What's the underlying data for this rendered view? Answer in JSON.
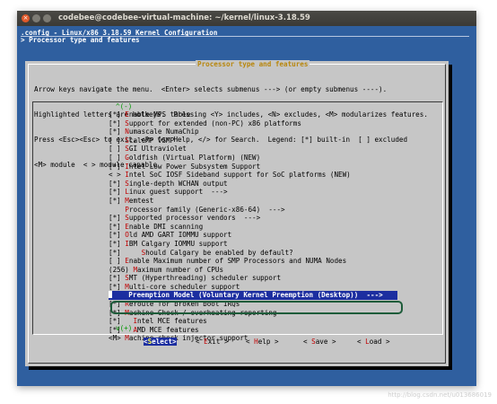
{
  "window": {
    "title": "codebee@codebee-virtual-machine: ~/kernel/linux-3.18.59",
    "close_glyph": "×"
  },
  "terminal": {
    "config_header": ".config - Linux/x86 3.18.59 Kernel Configuration",
    "breadcrumb": "> Processor type and features"
  },
  "dialog": {
    "title": "Processor type and features",
    "help_lines": [
      "Arrow keys navigate the menu.  <Enter> selects submenus ---> (or empty submenus ----).",
      "Highlighted letters are hotkeys.  Pressing <Y> includes, <N> excludes, <M> modularizes features.",
      "Press <Esc><Esc> to exit, <?> for Help, </> for Search.  Legend: [*] built-in  [ ] excluded",
      "<M> module  < > module capable"
    ],
    "scroll_up": "^(-)",
    "scroll_down": "v(+)",
    "items": [
      {
        "prefix": "[*] ",
        "hotkey": "E",
        "rest": "nable MPS table"
      },
      {
        "prefix": "[*] ",
        "hotkey": "S",
        "rest": "upport for extended (non-PC) x86 platforms"
      },
      {
        "prefix": "[*] ",
        "hotkey": "N",
        "rest": "umascale NumaChip"
      },
      {
        "prefix": "[ ] ",
        "hotkey": "S",
        "rest": "caleMP vSMP"
      },
      {
        "prefix": "[ ] ",
        "hotkey": "S",
        "rest": "GI Ultraviolet"
      },
      {
        "prefix": "[ ] ",
        "hotkey": "G",
        "rest": "oldfish (Virtual Platform) (NEW)"
      },
      {
        "prefix": "[*] ",
        "hotkey": "I",
        "rest": "ntel Low Power Subsystem Support"
      },
      {
        "prefix": "< > ",
        "hotkey": "I",
        "rest": "ntel SoC IOSF Sideband support for SoC platforms (NEW)"
      },
      {
        "prefix": "[*] ",
        "hotkey": "S",
        "rest": "ingle-depth WCHAN output"
      },
      {
        "prefix": "[*] ",
        "hotkey": "L",
        "rest": "inux guest support  --->"
      },
      {
        "prefix": "[*] ",
        "hotkey": "M",
        "rest": "emtest"
      },
      {
        "prefix": "    ",
        "hotkey": "P",
        "rest": "rocessor family (Generic-x86-64)  --->"
      },
      {
        "prefix": "[*] ",
        "hotkey": "S",
        "rest": "upported processor vendors  --->"
      },
      {
        "prefix": "[*] ",
        "hotkey": "E",
        "rest": "nable DMI scanning"
      },
      {
        "prefix": "[*] ",
        "hotkey": "O",
        "rest": "ld AMD GART IOMMU support"
      },
      {
        "prefix": "[*] ",
        "hotkey": "I",
        "rest": "BM Calgary IOMMU support"
      },
      {
        "prefix": "[*]     ",
        "hotkey": "S",
        "rest": "hould Calgary be enabled by default?"
      },
      {
        "prefix": "[ ] ",
        "hotkey": "E",
        "rest": "nable Maximum number of SMP Processors and NUMA Nodes"
      },
      {
        "prefix": "(256) ",
        "hotkey": "M",
        "rest": "aximum number of CPUs"
      },
      {
        "prefix": "[*] ",
        "hotkey": "S",
        "rest": "MT (Hyperthreading) scheduler support"
      },
      {
        "prefix": "[*] ",
        "hotkey": "M",
        "rest": "ulti-core scheduler support"
      },
      {
        "prefix": "    ",
        "hotkey": "P",
        "rest": "reemption Model (Voluntary Kernel Preemption (Desktop))  --->",
        "selected": true
      },
      {
        "prefix": "[*] ",
        "hotkey": "R",
        "rest": "eroute for broken boot IRQs"
      },
      {
        "prefix": "[*] ",
        "hotkey": "M",
        "rest": "achine Check / overheating reporting"
      },
      {
        "prefix": "[*]   ",
        "hotkey": "I",
        "rest": "ntel MCE features"
      },
      {
        "prefix": "[*]   ",
        "hotkey": "A",
        "rest": "MD MCE features"
      },
      {
        "prefix": "<M> ",
        "hotkey": "M",
        "rest": "achine check injector support"
      }
    ],
    "buttons": [
      {
        "open": "<",
        "hotkey": "S",
        "rest": "elect",
        "close": ">",
        "active": true
      },
      {
        "open": "< ",
        "hotkey": "E",
        "rest": "xit",
        "close": " >"
      },
      {
        "open": "< ",
        "hotkey": "H",
        "rest": "elp",
        "close": " >"
      },
      {
        "open": "< ",
        "hotkey": "S",
        "rest": "ave",
        "close": " >"
      },
      {
        "open": "< ",
        "hotkey": "L",
        "rest": "oad",
        "close": " >"
      }
    ]
  },
  "watermark": "http://blog.csdn.net/u013686019",
  "colors": {
    "terminal_bg": "#2f5f9f",
    "dialog_bg": "#c6c6c6",
    "selection_bg": "#1c2ea0",
    "hotkey": "#c00000",
    "scroll_indicator": "#009800",
    "annotation_outline": "#1e5c3a"
  }
}
